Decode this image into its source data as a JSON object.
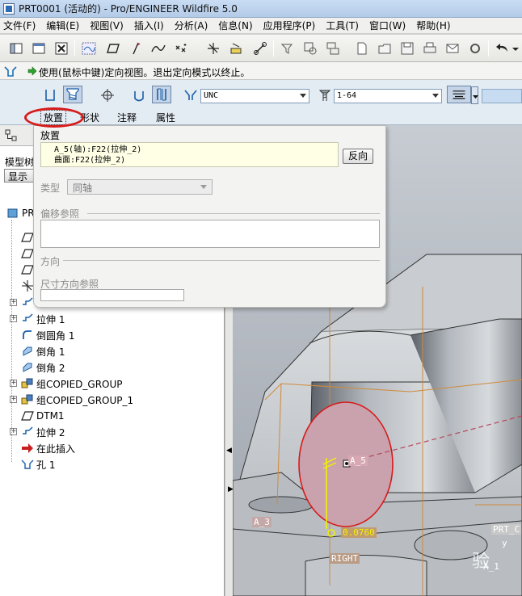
{
  "window": {
    "title": "PRT0001 (活动的) - Pro/ENGINEER Wildfire 5.0"
  },
  "menu": [
    "文件(F)",
    "编辑(E)",
    "视图(V)",
    "插入(I)",
    "分析(A)",
    "信息(N)",
    "应用程序(P)",
    "工具(T)",
    "窗口(W)",
    "帮助(H)"
  ],
  "message": {
    "text": "使用(鼠标中键)定向视图。退出定向模式以终止。"
  },
  "dashboard": {
    "thread_standard": "UNC",
    "screw_size": "1-64",
    "tabs": [
      "放置",
      "形状",
      "注释",
      "属性"
    ],
    "active_tab": "放置"
  },
  "placement_panel": {
    "title": "放置",
    "references": [
      "A_5(轴):F22(拉伸_2)",
      "曲面:F22(拉伸_2)"
    ],
    "flip_button": "反向",
    "type_label": "类型",
    "type_value": "同轴",
    "offset_refs_label": "偏移参照",
    "direction_label": "方向",
    "dim_direction_label": "尺寸方向参照"
  },
  "nav": {
    "tab_label": "模型树",
    "show_button": "显示"
  },
  "model_tree": [
    {
      "label": "PR",
      "icon": "part-icon",
      "expander": false
    },
    {
      "label": "",
      "icon": "datum-plane-icon",
      "expander": false
    },
    {
      "label": "",
      "icon": "datum-plane-icon",
      "expander": false
    },
    {
      "label": "",
      "icon": "datum-plane-icon",
      "expander": false
    },
    {
      "label": "",
      "icon": "coordinate-system-icon",
      "expander": false
    },
    {
      "label": "",
      "icon": "extrude-icon",
      "expander": true
    },
    {
      "label": "拉伸 1",
      "icon": "extrude-icon",
      "expander": true
    },
    {
      "label": "倒圆角 1",
      "icon": "round-icon",
      "expander": false
    },
    {
      "label": "倒角 1",
      "icon": "chamfer-icon",
      "expander": false
    },
    {
      "label": "倒角 2",
      "icon": "chamfer-icon",
      "expander": false
    },
    {
      "label": "组COPIED_GROUP",
      "icon": "group-icon",
      "expander": true
    },
    {
      "label": "组COPIED_GROUP_1",
      "icon": "group-icon",
      "expander": true
    },
    {
      "label": "DTM1",
      "icon": "datum-plane-icon",
      "expander": false
    },
    {
      "label": "拉伸 2",
      "icon": "extrude-icon",
      "expander": true
    },
    {
      "label": "在此插入",
      "icon": "insert-here-icon",
      "expander": false
    },
    {
      "label": "孔 1",
      "icon": "hole-icon",
      "expander": false
    }
  ],
  "graphics_labels": {
    "axis_tag": "A_5",
    "axis_tag_left": "A_3",
    "dimension": "0.0760",
    "plane_right": "RIGHT",
    "plane_prt": "PRT_C",
    "axis_y": "y",
    "axis_a1": "A_1",
    "watermark": "验"
  },
  "colors": {
    "hole_highlight": "#c9a2ad",
    "selection_red": "#d71b1b",
    "dimension_yellow": "#f2f200"
  }
}
